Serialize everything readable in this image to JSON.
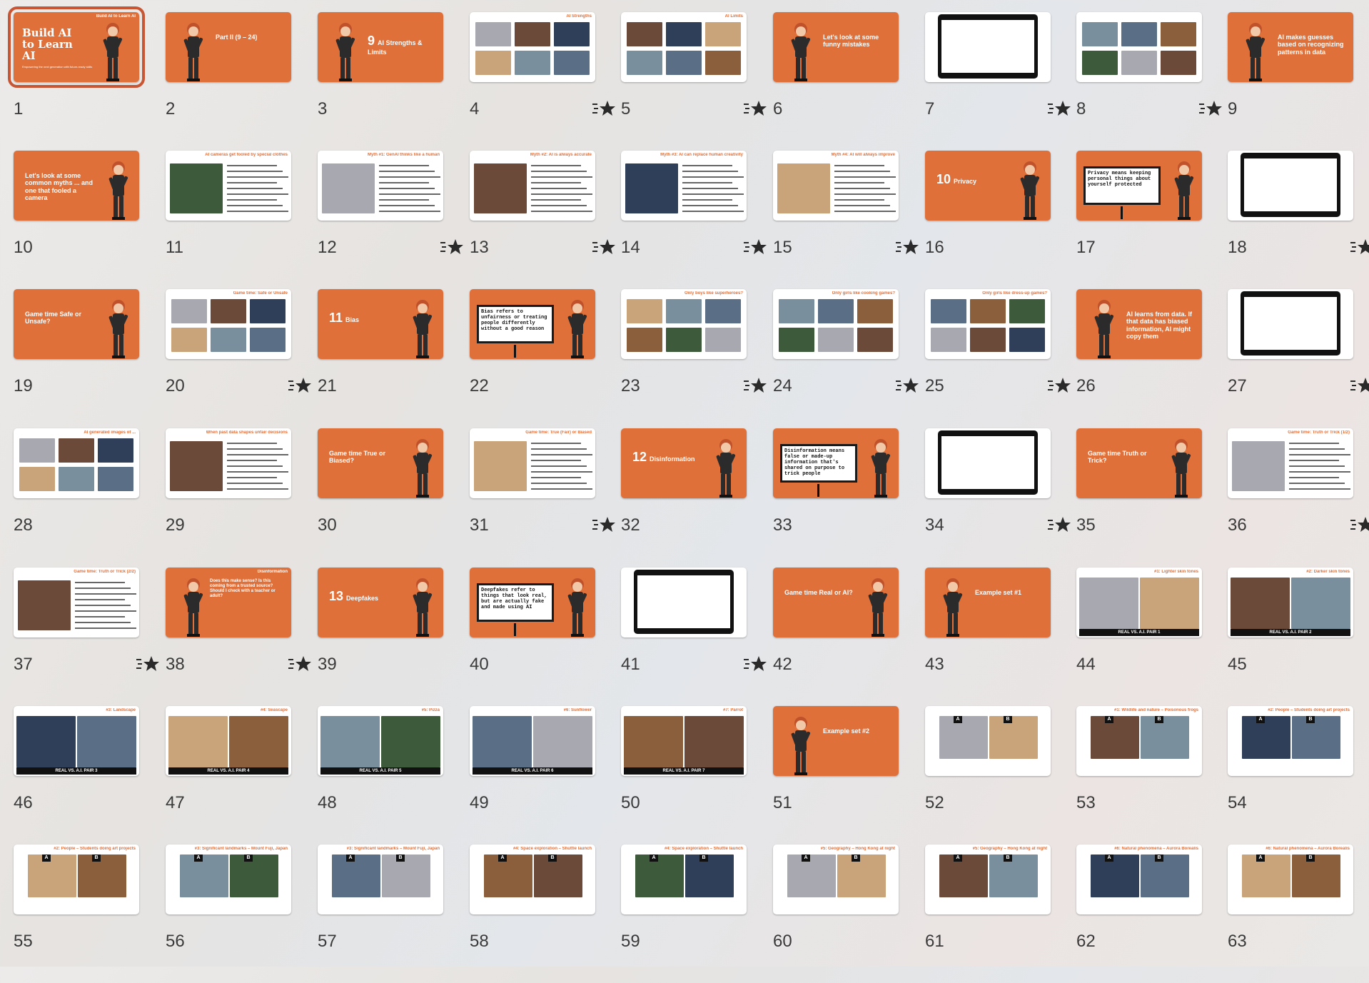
{
  "slides": [
    {
      "n": "1",
      "kind": "cover",
      "title": "Build AI to Learn AI",
      "sub": "Empowering the next generation with future-ready skills"
    },
    {
      "n": "2",
      "kind": "orange",
      "text": "Part II (9 – 24)"
    },
    {
      "n": "3",
      "kind": "orange",
      "num": "9",
      "text": "AI Strengths & Limits"
    },
    {
      "n": "4",
      "kind": "photos",
      "title": "AI Strengths",
      "star": true
    },
    {
      "n": "5",
      "kind": "photos",
      "title": "AI Limits",
      "star": true
    },
    {
      "n": "6",
      "kind": "orange",
      "text": "Let's look at some funny mistakes"
    },
    {
      "n": "7",
      "kind": "laptop",
      "star": true
    },
    {
      "n": "8",
      "kind": "photos",
      "title": "",
      "star": true
    },
    {
      "n": "9",
      "kind": "orange",
      "text": "AI makes guesses based on recognizing patterns in data"
    },
    {
      "n": "10",
      "kind": "orange",
      "text": "Let's look at some common myths ... and one that fooled a camera",
      "left": true
    },
    {
      "n": "11",
      "kind": "text",
      "title": "AI cameras get fooled by special clothes"
    },
    {
      "n": "12",
      "kind": "text",
      "title": "Myth #1: GenAI thinks like a human",
      "star": true
    },
    {
      "n": "13",
      "kind": "text",
      "title": "Myth #2: AI is always accurate",
      "star": true
    },
    {
      "n": "14",
      "kind": "text",
      "title": "Myth #3: AI can replace human creativity",
      "star": true
    },
    {
      "n": "15",
      "kind": "text",
      "title": "Myth #4: AI will always improve",
      "star": true
    },
    {
      "n": "16",
      "kind": "orange",
      "num": "10",
      "text": "Privacy",
      "left": true
    },
    {
      "n": "17",
      "kind": "board",
      "text": "Privacy means keeping personal things about yourself protected"
    },
    {
      "n": "18",
      "kind": "laptop",
      "star": true
    },
    {
      "n": "19",
      "kind": "orange",
      "text": "Game time Safe or Unsafe?",
      "left": true
    },
    {
      "n": "20",
      "kind": "photos",
      "title": "Game time: Safe or Unsafe",
      "star": true
    },
    {
      "n": "21",
      "kind": "orange",
      "num": "11",
      "text": "Bias",
      "left": true
    },
    {
      "n": "22",
      "kind": "board",
      "text": "Bias refers to unfairness or treating people differently without a good reason"
    },
    {
      "n": "23",
      "kind": "photos",
      "title": "Only boys like superheroes?",
      "star": true
    },
    {
      "n": "24",
      "kind": "photos",
      "title": "Only girls like cooking games?",
      "star": true
    },
    {
      "n": "25",
      "kind": "photos",
      "title": "Only girls like dress-up games?",
      "star": true
    },
    {
      "n": "26",
      "kind": "orange",
      "text": "AI learns from data. If that data has biased information, AI might copy them"
    },
    {
      "n": "27",
      "kind": "laptop",
      "star": true
    },
    {
      "n": "28",
      "kind": "photos",
      "title": "AI generated images of ..."
    },
    {
      "n": "29",
      "kind": "text",
      "title": "When past data shapes unfair decisions"
    },
    {
      "n": "30",
      "kind": "orange",
      "text": "Game time True or Biased?",
      "left": true
    },
    {
      "n": "31",
      "kind": "text",
      "title": "Game time: True (Fair) or Biased",
      "star": true
    },
    {
      "n": "32",
      "kind": "orange",
      "num": "12",
      "text": "Disinformation",
      "left": true
    },
    {
      "n": "33",
      "kind": "board",
      "text": "Disinformation means false or made-up information that's shared on purpose to trick people"
    },
    {
      "n": "34",
      "kind": "laptop",
      "star": true
    },
    {
      "n": "35",
      "kind": "orange",
      "text": "Game time Truth or Trick?",
      "left": true
    },
    {
      "n": "36",
      "kind": "text",
      "title": "Game time: Truth or Trick (1/2)",
      "star": true
    },
    {
      "n": "37",
      "kind": "text",
      "title": "Game time: Truth or Trick (2/2)",
      "star": true
    },
    {
      "n": "38",
      "kind": "orange",
      "title": "Disinformation",
      "text": "Does this make sense? Is this coming from a trusted source? Should I check with a teacher or adult?",
      "star": true
    },
    {
      "n": "39",
      "kind": "orange",
      "num": "13",
      "text": "Deepfakes",
      "left": true
    },
    {
      "n": "40",
      "kind": "board",
      "text": "Deepfakes refer to things that look real, but are actually fake and made using AI"
    },
    {
      "n": "41",
      "kind": "laptop",
      "star": true
    },
    {
      "n": "42",
      "kind": "orange",
      "text": "Game time Real or AI?",
      "left": true
    },
    {
      "n": "43",
      "kind": "orange",
      "text": "Example set #1"
    },
    {
      "n": "44",
      "kind": "pair",
      "title": "#1: Lighter skin tones",
      "bar": "REAL VS. A.I. PAIR 1"
    },
    {
      "n": "45",
      "kind": "pair",
      "title": "#2: Darker skin tones",
      "bar": "REAL VS. A.I. PAIR 2"
    },
    {
      "n": "46",
      "kind": "pair",
      "title": "#3: Landscape",
      "bar": "REAL VS. A.I. PAIR 3"
    },
    {
      "n": "47",
      "kind": "pair",
      "title": "#4: Seascape",
      "bar": "REAL VS. A.I. PAIR 4"
    },
    {
      "n": "48",
      "kind": "pair",
      "title": "#5: Pizza",
      "bar": "REAL VS. A.I. PAIR 5"
    },
    {
      "n": "49",
      "kind": "pair",
      "title": "#6: Sunflower",
      "bar": "REAL VS. A.I. PAIR 6"
    },
    {
      "n": "50",
      "kind": "pair",
      "title": "#7: Parrot",
      "bar": "REAL VS. A.I. PAIR 7"
    },
    {
      "n": "51",
      "kind": "orange",
      "text": "Example set #2"
    },
    {
      "n": "52",
      "kind": "abpair",
      "title": ""
    },
    {
      "n": "53",
      "kind": "abpair",
      "title": "#1: Wildlife and nature – Poisonous frogs"
    },
    {
      "n": "54",
      "kind": "abpair",
      "title": "#2: People – Students doing art projects"
    },
    {
      "n": "55",
      "kind": "abpair",
      "title": "#2: People – Students doing art projects"
    },
    {
      "n": "56",
      "kind": "abpair",
      "title": "#3: Significant landmarks – Mount Fuji, Japan"
    },
    {
      "n": "57",
      "kind": "abpair",
      "title": "#3: Significant landmarks – Mount Fuji, Japan"
    },
    {
      "n": "58",
      "kind": "abpair",
      "title": "#4: Space exploration – Shuttle launch"
    },
    {
      "n": "59",
      "kind": "abpair",
      "title": "#4: Space exploration – Shuttle launch"
    },
    {
      "n": "60",
      "kind": "abpair",
      "title": "#5: Geography – Hong Kong at night"
    },
    {
      "n": "61",
      "kind": "abpair",
      "title": "#5: Geography – Hong Kong at night"
    },
    {
      "n": "62",
      "kind": "abpair",
      "title": "#6: Natural phenomena – Aurora Borealis"
    },
    {
      "n": "63",
      "kind": "abpair",
      "title": "#6: Natural phenomena – Aurora Borealis"
    }
  ],
  "colors": {
    "accent": "#e0703a",
    "selected_outline": "#c85634",
    "page_bg": "#e8e6e4"
  },
  "icons": {
    "star": "star-with-dashes-icon",
    "character": "cartoon-kid-icon"
  }
}
